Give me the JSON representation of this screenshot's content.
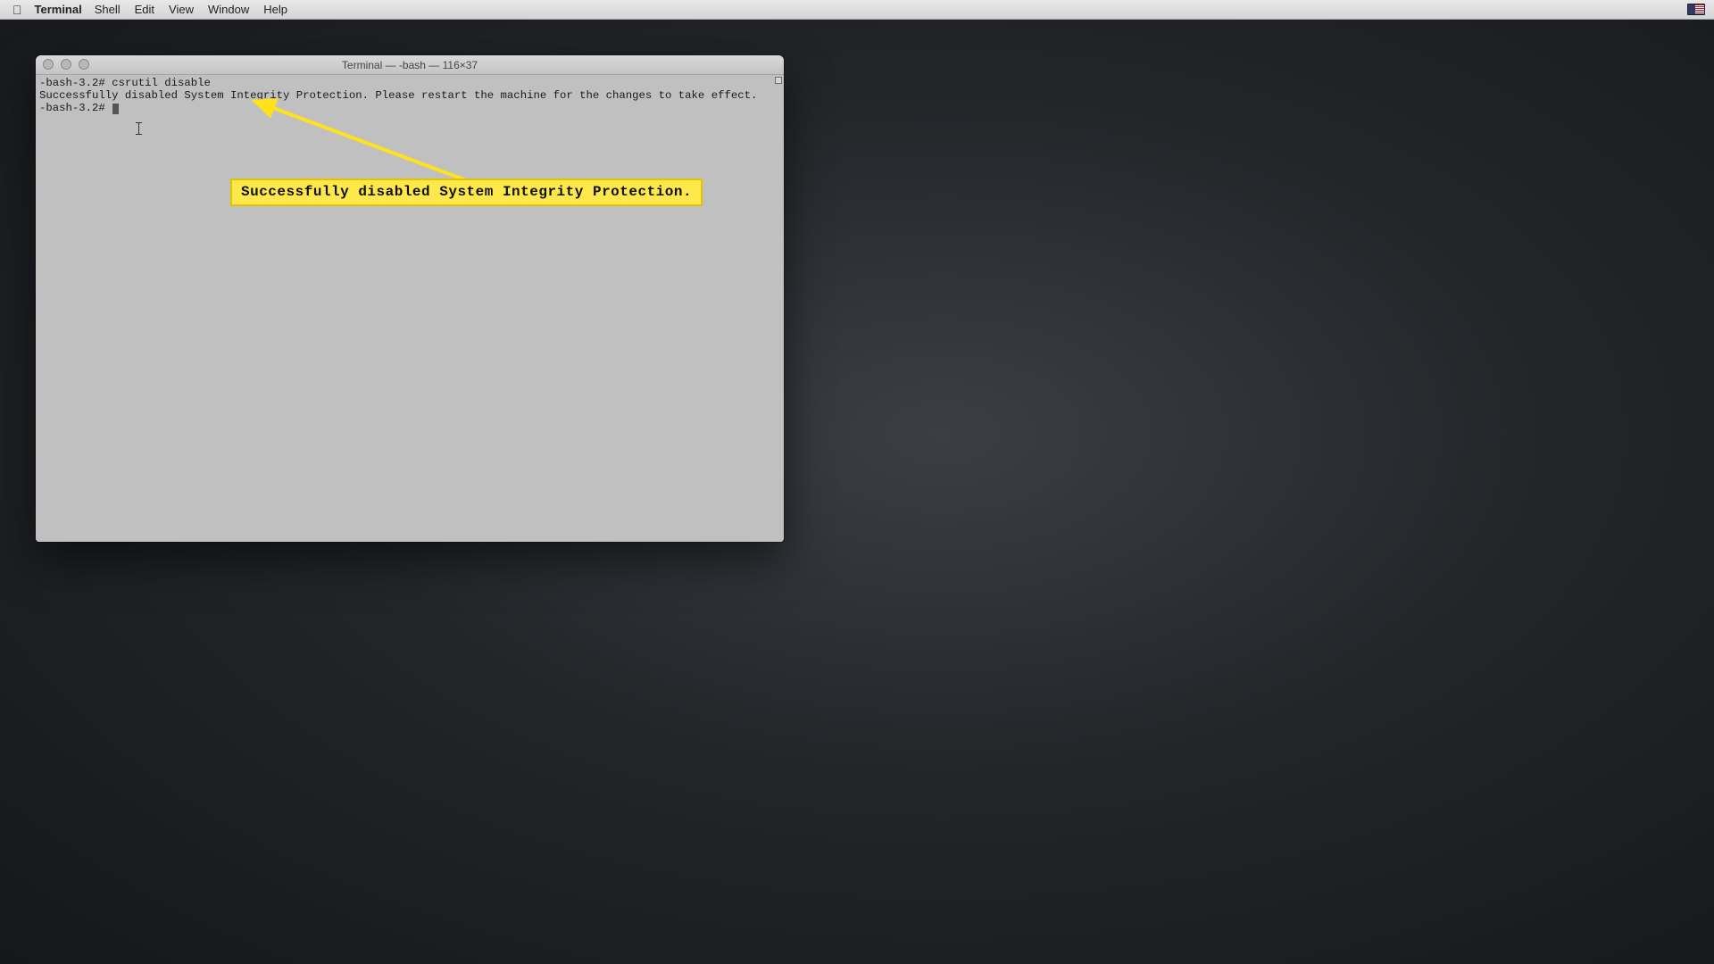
{
  "menubar": {
    "app": "Terminal",
    "items": [
      "Shell",
      "Edit",
      "View",
      "Window",
      "Help"
    ]
  },
  "window": {
    "title": "Terminal — -bash — 116×37"
  },
  "terminal": {
    "line1_prompt": "-bash-3.2#",
    "line1_cmd": "csrutil disable",
    "line2": "Successfully disabled System Integrity Protection. Please restart the machine for the changes to take effect.",
    "line3_prompt": "-bash-3.2#"
  },
  "annotation": {
    "text": "Successfully disabled System Integrity Protection."
  }
}
